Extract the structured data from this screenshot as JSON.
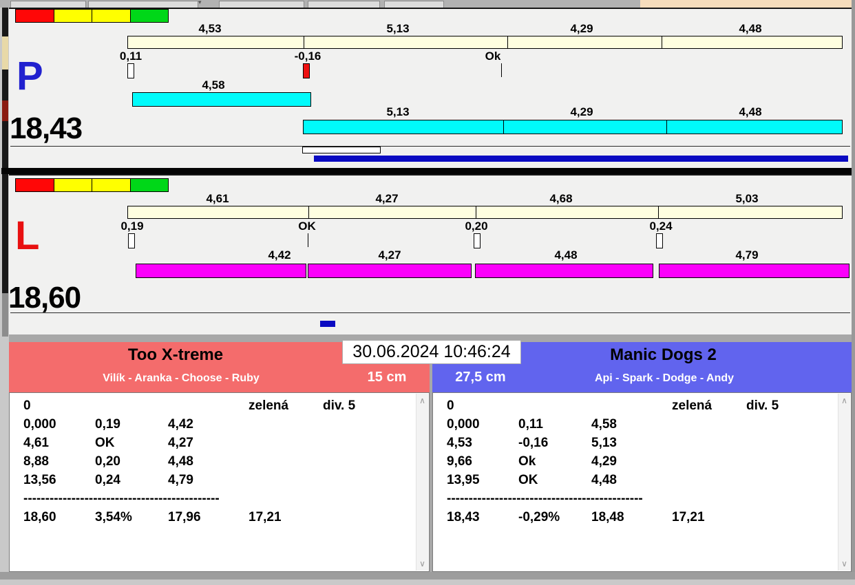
{
  "colors": {
    "team_red": "#f46c6c",
    "team_blue": "#6164ee",
    "cream": "#ffffe0",
    "cyan": "#00fbfb",
    "magenta": "#fb00fb",
    "bar_blue": "#0a0ac2",
    "p_letter": "#2121cf",
    "l_letter": "#e81010",
    "peach": "#f5dcbc",
    "tl_red": "#ff0707",
    "tl_yellow": "#ffff00",
    "tl_green": "#00d718"
  },
  "datetime": "30.06.2024 10:46:24",
  "p_gauge": {
    "letter": "P",
    "total": "18,43",
    "ruler": [
      "4,53",
      "5,13",
      "4,29",
      "4,48"
    ],
    "ticks": [
      "0,11",
      "-0,16",
      "Ok"
    ],
    "bar1": "4,58",
    "bar2": [
      "5,13",
      "4,29",
      "4,48"
    ]
  },
  "l_gauge": {
    "letter": "L",
    "total": "18,60",
    "ruler": [
      "4,61",
      "4,27",
      "4,68",
      "5,03"
    ],
    "ticks": [
      "0,19",
      "OK",
      "0,20",
      "0,24"
    ],
    "bars": [
      "4,42",
      "4,27",
      "4,48",
      "4,79"
    ]
  },
  "team_left": {
    "name": "Too X-treme",
    "dogs": "Vilík - Aranka - Choose - Ruby",
    "height": "15 cm",
    "rows": [
      [
        "0",
        "",
        "",
        "zelená",
        "div. 5"
      ],
      [
        "0,000",
        "0,19",
        "4,42"
      ],
      [
        "4,61",
        "OK",
        "4,27"
      ],
      [
        "8,88",
        "0,20",
        "4,48"
      ],
      [
        "13,56",
        "0,24",
        "4,79"
      ],
      [
        "---------------------------------------------"
      ],
      [
        "18,60",
        "3,54%",
        "17,96",
        "17,21"
      ]
    ]
  },
  "team_right": {
    "name": "Manic Dogs 2",
    "dogs": "Api - Spark - Dodge - Andy",
    "height": "27,5 cm",
    "rows": [
      [
        "0",
        "",
        "",
        "zelená",
        "div. 5"
      ],
      [
        "0,000",
        "0,11",
        "4,58"
      ],
      [
        "4,53",
        "-0,16",
        "5,13"
      ],
      [
        "9,66",
        "Ok",
        "4,29"
      ],
      [
        "13,95",
        "OK",
        "4,48"
      ],
      [
        "---------------------------------------------"
      ],
      [
        "18,43",
        "-0,29%",
        "18,48",
        "17,21"
      ]
    ]
  }
}
